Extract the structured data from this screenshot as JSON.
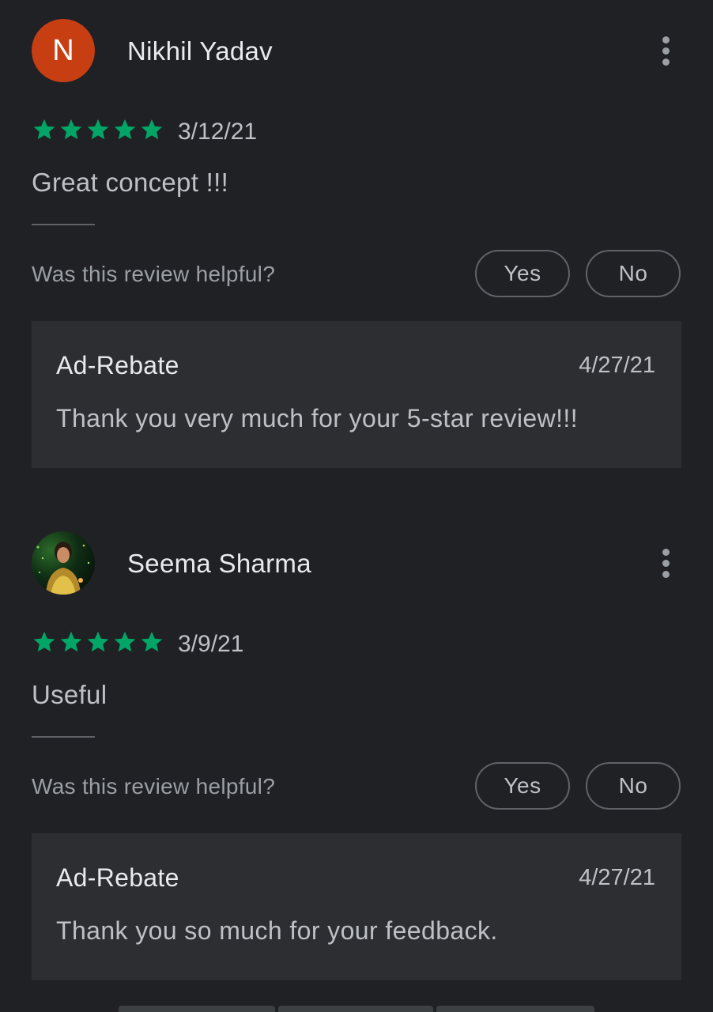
{
  "colors": {
    "background": "#202124",
    "star": "#01a667",
    "reply_background": "#2d2e31",
    "avatar_letter_background": "#c73e13"
  },
  "reviews": [
    {
      "avatar_letter": "N",
      "name": "Nikhil Yadav",
      "rating": 5,
      "date": "3/12/21",
      "text": "Great concept !!!",
      "helpful_prompt": "Was this review helpful?",
      "yes_label": "Yes",
      "no_label": "No",
      "reply": {
        "author": "Ad-Rebate",
        "date": "4/27/21",
        "text": "Thank you very much for your 5-star review!!!"
      }
    },
    {
      "avatar_letter": "",
      "name": "Seema Sharma",
      "rating": 5,
      "date": "3/9/21",
      "text": "Useful",
      "helpful_prompt": "Was this review helpful?",
      "yes_label": "Yes",
      "no_label": "No",
      "reply": {
        "author": "Ad-Rebate",
        "date": "4/27/21",
        "text": "Thank you so much for your feedback."
      }
    }
  ]
}
